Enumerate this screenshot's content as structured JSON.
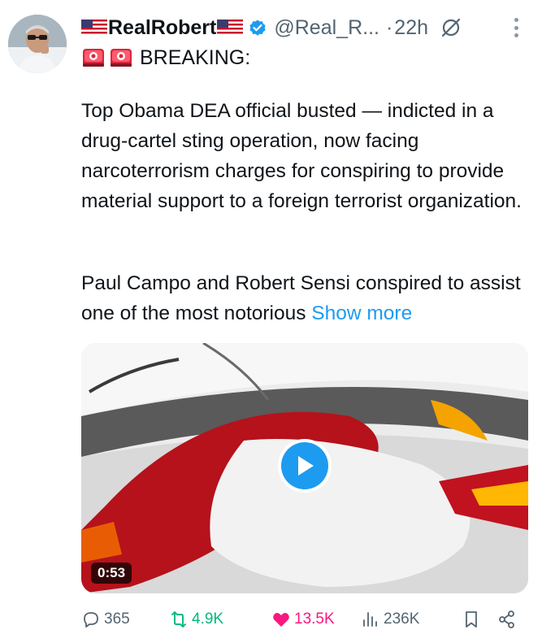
{
  "tweet": {
    "author": {
      "display_name": "RealRobert",
      "handle": "@Real_R...",
      "verified": true,
      "flag_icon": "us-flag-icon"
    },
    "separator": "·",
    "time": "22h",
    "header_prefix": "BREAKING:",
    "prefix_icons": [
      "siren-icon",
      "siren-icon"
    ],
    "paragraph1": "Top Obama DEA official busted — indicted in a drug-cartel sting operation, now facing narcoterrorism charges for conspiring to provide material support to a foreign terrorist organization.",
    "paragraph2": "Paul Campo and Robert Sensi conspired to assist one of the most notorious ",
    "show_more": "Show more",
    "media": {
      "type": "video",
      "duration": "0:53"
    },
    "stats": {
      "replies": "365",
      "reposts": "4.9K",
      "likes": "13.5K",
      "views": "236K"
    }
  },
  "colors": {
    "accent": "#1d9bf0",
    "repost_active": "#00ba7c",
    "like_active": "#f91880",
    "muted": "#536471"
  }
}
